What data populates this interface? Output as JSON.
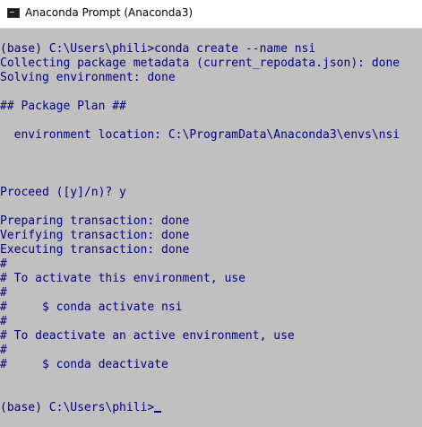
{
  "window": {
    "title": "Anaconda Prompt (Anaconda3)",
    "icon": "terminal-icon"
  },
  "colors": {
    "console_background": "#c0c0c0",
    "console_text": "#000080"
  },
  "console": {
    "lines": [
      "(base) C:\\Users\\phili>conda create --name nsi",
      "Collecting package metadata (current_repodata.json): done",
      "Solving environment: done",
      "",
      "## Package Plan ##",
      "",
      "  environment location: C:\\ProgramData\\Anaconda3\\envs\\nsi",
      "",
      "",
      "",
      "Proceed ([y]/n)? y",
      "",
      "Preparing transaction: done",
      "Verifying transaction: done",
      "Executing transaction: done",
      "#",
      "# To activate this environment, use",
      "#",
      "#     $ conda activate nsi",
      "#",
      "# To deactivate an active environment, use",
      "#",
      "#     $ conda deactivate",
      "",
      "",
      "(base) C:\\Users\\phili>"
    ]
  }
}
